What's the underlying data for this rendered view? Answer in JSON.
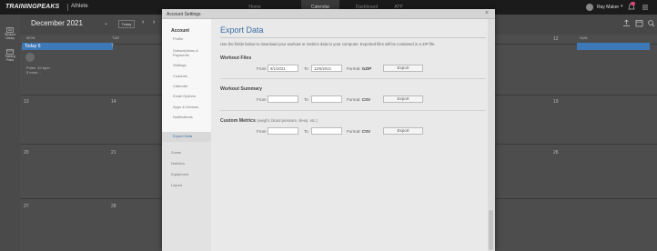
{
  "topbar": {
    "brand": "TRAININGPEAKS",
    "brand_sub": "Athlete",
    "nav": [
      "Home",
      "Calendar",
      "Dashboard",
      "ATP"
    ],
    "active_nav": "Calendar",
    "user_name": "Ray Maker",
    "colors": {
      "bg": "#1b1b1b",
      "badge": "#e0467c"
    }
  },
  "rail": {
    "items": [
      {
        "label_line1": "Workout",
        "label_line2": "Library",
        "icon": "workout-library-icon"
      },
      {
        "label_line1": "Training",
        "label_line2": "Plans",
        "icon": "training-plans-icon"
      }
    ]
  },
  "calendar": {
    "month": "December 2021",
    "today_button": "Today",
    "day_headers": [
      "MON",
      "TUE",
      "SUN"
    ],
    "today_label": "Today 6",
    "day_7": "7",
    "day_12": "12",
    "week_days": [
      "13",
      "14",
      "19",
      "20",
      "21",
      "26",
      "27",
      "28"
    ],
    "workout": {
      "line1": "Pulse: 10 bpm",
      "line2": "5 more..."
    },
    "accent": "#3d79b8"
  },
  "modal": {
    "title": "Account Settings",
    "close": "×",
    "sidebar": {
      "heading": "Account",
      "items": [
        "Profile",
        "Subscriptions &",
        "Payments",
        "Settings",
        "Coaches",
        "Calendar",
        "Email Options",
        "Apps & Devices",
        "Notifications",
        "Export Data"
      ],
      "active": "Export Data",
      "lower_items": [
        "Zones",
        "Nutrition",
        "Equipment",
        "Layout"
      ]
    },
    "content": {
      "heading": "Export Data",
      "intro": "Use the fields below to download your workout or metrics data to your computer. Exported files will be contained in a ZIP file.",
      "sections": [
        {
          "title": "Workout Files",
          "subtitle": "",
          "from_label": "From",
          "from_value": "9/1/2021",
          "to_label": "To",
          "to_value": "12/6/2021",
          "format_label": "Format:",
          "format_value": "GZIP",
          "button": "Export"
        },
        {
          "title": "Workout Summary",
          "subtitle": "",
          "from_label": "From",
          "from_value": "",
          "to_label": "To",
          "to_value": "",
          "format_label": "Format:",
          "format_value": "CSV",
          "button": "Export"
        },
        {
          "title": "Custom Metrics",
          "subtitle": "(weight, blood pressure, sleep, etc.)",
          "from_label": "From",
          "from_value": "",
          "to_label": "To",
          "to_value": "",
          "format_label": "Format:",
          "format_value": "CSV",
          "button": "Export"
        }
      ],
      "heading_color": "#3a6ea5"
    }
  }
}
